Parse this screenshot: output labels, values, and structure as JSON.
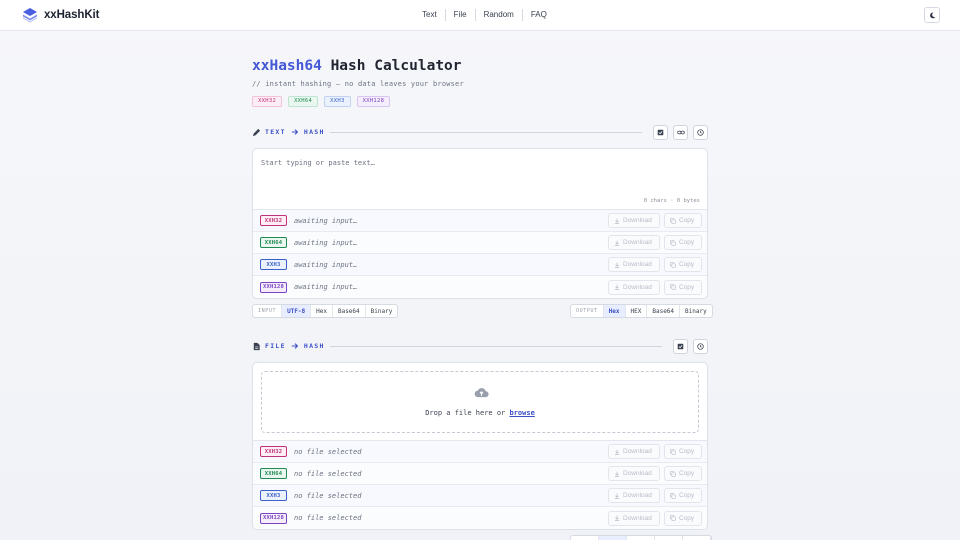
{
  "navbar": {
    "brand": "xxHashKit",
    "links": [
      "Text",
      "File",
      "Random",
      "FAQ"
    ],
    "theme_icon": "moon-icon"
  },
  "page": {
    "title_accent": "xxHash64",
    "title_rest": " Hash Calculator",
    "subtitle": "// instant hashing — no data leaves your browser",
    "badges": [
      "XXH32",
      "XXH64",
      "XXH3",
      "XXH128"
    ]
  },
  "text_section": {
    "label_from": "TEXT",
    "label_to": "HASH",
    "placeholder": "Start typing or paste text…",
    "counter": "0 chars · 0 bytes",
    "rows": [
      {
        "algo": "XXH32",
        "status": "awaiting input…"
      },
      {
        "algo": "XXH64",
        "status": "awaiting input…"
      },
      {
        "algo": "XXH3",
        "status": "awaiting input…"
      },
      {
        "algo": "XXH128",
        "status": "awaiting input…"
      }
    ],
    "download_label": "Download",
    "copy_label": "Copy",
    "input_encoding": {
      "label": "INPUT",
      "options": [
        "UTF-8",
        "Hex",
        "Base64",
        "Binary"
      ],
      "selected": "UTF-8"
    },
    "output_encoding": {
      "label": "OUTPUT",
      "options": [
        "Hex",
        "HEX",
        "Base64",
        "Binary"
      ],
      "selected": "Hex"
    }
  },
  "file_section": {
    "label_from": "FILE",
    "label_to": "HASH",
    "drop_text": "Drop a file here or ",
    "browse_label": "browse",
    "rows": [
      {
        "algo": "XXH32",
        "status": "no file selected"
      },
      {
        "algo": "XXH64",
        "status": "no file selected"
      },
      {
        "algo": "XXH3",
        "status": "no file selected"
      },
      {
        "algo": "XXH128",
        "status": "no file selected"
      }
    ],
    "download_label": "Download",
    "copy_label": "Copy"
  },
  "colors": {
    "accent": "#3b4fc6",
    "xxh32": "#c0337a",
    "xxh64": "#1f8a52",
    "xxh3": "#3b62c7",
    "xxh128": "#7b44c2"
  }
}
